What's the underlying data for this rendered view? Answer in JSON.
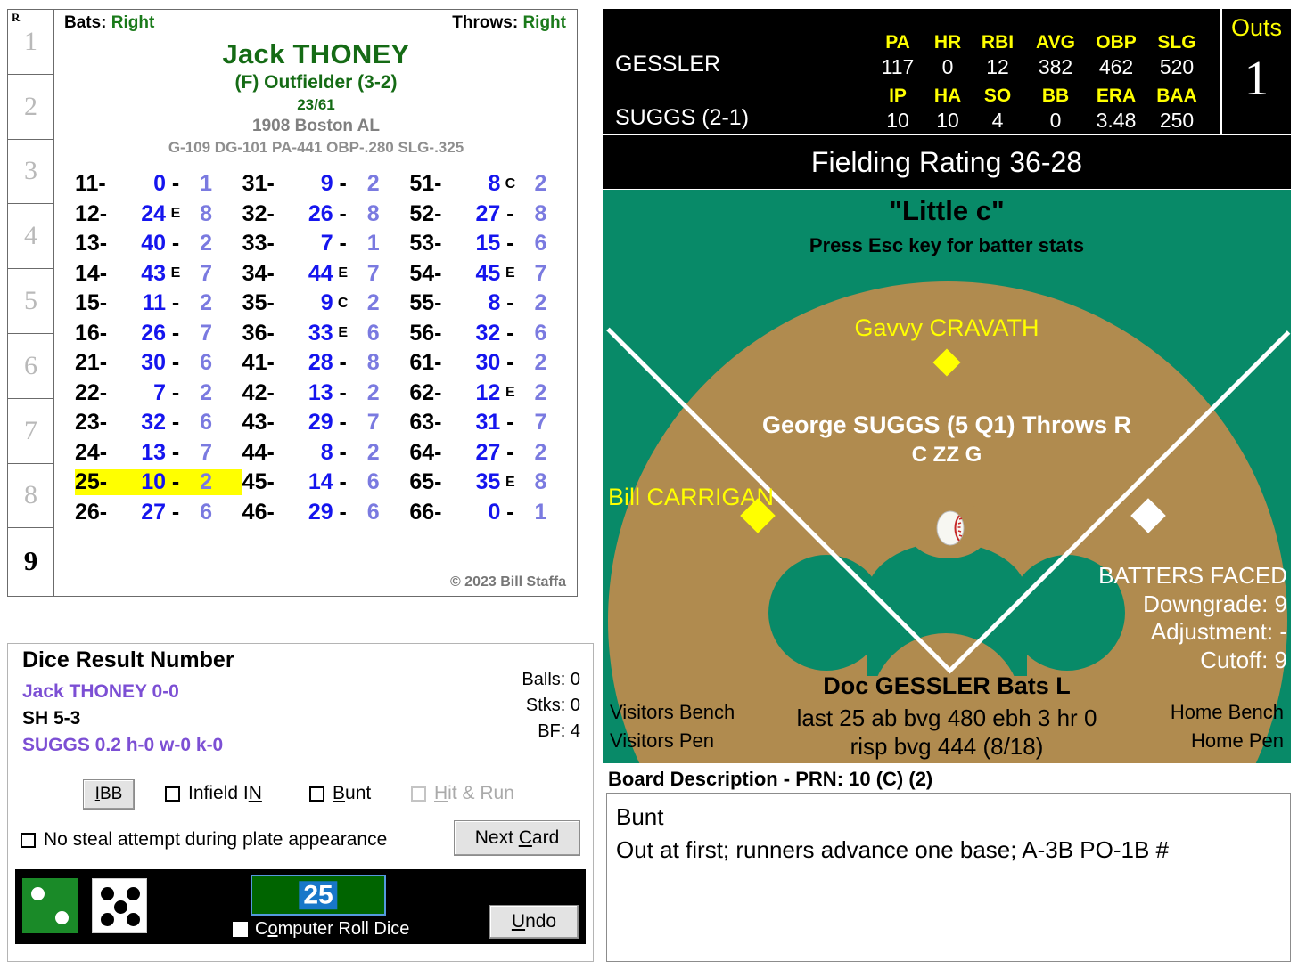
{
  "inning_column": {
    "header": "R",
    "innings": [
      "1",
      "2",
      "3",
      "4",
      "5",
      "6",
      "7",
      "8",
      "9"
    ],
    "current_index": 8
  },
  "batter_card": {
    "bats_label": "Bats:",
    "bats_value": "Right",
    "throws_label": "Throws:",
    "throws_value": "Right",
    "player_name": "Jack THONEY",
    "position": "(F) Outfielder (3-2)",
    "ratio": "23/61",
    "team_year": "1908 Boston AL",
    "stat_line": "G-109 DG-101 PA-441 OBP-.280 SLG-.325",
    "copyright": "© 2023 Bill Staffa",
    "rows": [
      [
        {
          "roll": "11-",
          "mid": "0",
          "sep": "-",
          "last": "1"
        },
        {
          "roll": "31-",
          "mid": "9",
          "sep": "-",
          "last": "2"
        },
        {
          "roll": "51-",
          "mid": "8",
          "sep": "C",
          "last": "2"
        }
      ],
      [
        {
          "roll": "12-",
          "mid": "24",
          "sep": "E",
          "last": "8"
        },
        {
          "roll": "32-",
          "mid": "26",
          "sep": "-",
          "last": "8"
        },
        {
          "roll": "52-",
          "mid": "27",
          "sep": "-",
          "last": "8"
        }
      ],
      [
        {
          "roll": "13-",
          "mid": "40",
          "sep": "-",
          "last": "2"
        },
        {
          "roll": "33-",
          "mid": "7",
          "sep": "-",
          "last": "1"
        },
        {
          "roll": "53-",
          "mid": "15",
          "sep": "-",
          "last": "6"
        }
      ],
      [
        {
          "roll": "14-",
          "mid": "43",
          "sep": "E",
          "last": "7"
        },
        {
          "roll": "34-",
          "mid": "44",
          "sep": "E",
          "last": "7"
        },
        {
          "roll": "54-",
          "mid": "45",
          "sep": "E",
          "last": "7"
        }
      ],
      [
        {
          "roll": "15-",
          "mid": "11",
          "sep": "-",
          "last": "2"
        },
        {
          "roll": "35-",
          "mid": "9",
          "sep": "C",
          "last": "2"
        },
        {
          "roll": "55-",
          "mid": "8",
          "sep": "-",
          "last": "2"
        }
      ],
      [
        {
          "roll": "16-",
          "mid": "26",
          "sep": "-",
          "last": "7"
        },
        {
          "roll": "36-",
          "mid": "33",
          "sep": "E",
          "last": "6"
        },
        {
          "roll": "56-",
          "mid": "32",
          "sep": "-",
          "last": "6"
        }
      ],
      [
        {
          "roll": "21-",
          "mid": "30",
          "sep": "-",
          "last": "6"
        },
        {
          "roll": "41-",
          "mid": "28",
          "sep": "-",
          "last": "8"
        },
        {
          "roll": "61-",
          "mid": "30",
          "sep": "-",
          "last": "2"
        }
      ],
      [
        {
          "roll": "22-",
          "mid": "7",
          "sep": "-",
          "last": "2"
        },
        {
          "roll": "42-",
          "mid": "13",
          "sep": "-",
          "last": "2"
        },
        {
          "roll": "62-",
          "mid": "12",
          "sep": "E",
          "last": "2"
        }
      ],
      [
        {
          "roll": "23-",
          "mid": "32",
          "sep": "-",
          "last": "6"
        },
        {
          "roll": "43-",
          "mid": "29",
          "sep": "-",
          "last": "7"
        },
        {
          "roll": "63-",
          "mid": "31",
          "sep": "-",
          "last": "7"
        }
      ],
      [
        {
          "roll": "24-",
          "mid": "13",
          "sep": "-",
          "last": "7"
        },
        {
          "roll": "44-",
          "mid": "8",
          "sep": "-",
          "last": "2"
        },
        {
          "roll": "64-",
          "mid": "27",
          "sep": "-",
          "last": "2"
        }
      ],
      [
        {
          "roll": "25-",
          "mid": "10",
          "sep": "-",
          "last": "2",
          "highlight": true
        },
        {
          "roll": "45-",
          "mid": "14",
          "sep": "-",
          "last": "6"
        },
        {
          "roll": "65-",
          "mid": "35",
          "sep": "E",
          "last": "8"
        }
      ],
      [
        {
          "roll": "26-",
          "mid": "27",
          "sep": "-",
          "last": "6"
        },
        {
          "roll": "46-",
          "mid": "29",
          "sep": "-",
          "last": "6"
        },
        {
          "roll": "66-",
          "mid": "0",
          "sep": "-",
          "last": "1"
        }
      ]
    ]
  },
  "dice_panel": {
    "title": "Dice Result Number",
    "batter_line": "Jack THONEY  0-0",
    "situation_line": "SH 5-3",
    "pitcher_line": "SUGGS  0.2  h-0  w-0  k-0",
    "balls": "Balls: 0",
    "strikes": "Stks: 0",
    "bf": "BF: 4",
    "ibb_label": "IBB",
    "infield_in_label": "Infield IN",
    "bunt_label": "Bunt",
    "hit_run_label": "Hit & Run",
    "no_steal_label": "No steal attempt during plate appearance",
    "next_card_label": "Next Card",
    "undo_label": "Undo",
    "computer_roll_label": "Computer Roll Dice",
    "dice_value": "25",
    "die_green_pips": 2,
    "die_white_pips": 5
  },
  "scoreboard": {
    "batter_name": "GESSLER",
    "batter_headers": [
      "PA",
      "HR",
      "RBI",
      "AVG",
      "OBP",
      "SLG"
    ],
    "batter_values": [
      "117",
      "0",
      "12",
      "382",
      "462",
      "520"
    ],
    "pitcher_name": "SUGGS (2-1)",
    "pitcher_headers": [
      "IP",
      "HA",
      "SO",
      "BB",
      "ERA",
      "BAA"
    ],
    "pitcher_values": [
      "10",
      "10",
      "4",
      "0",
      "3.48",
      "250"
    ],
    "outs_label": "Outs",
    "outs_value": "1",
    "fielding_rating": "Fielding Rating 36-28"
  },
  "field": {
    "little_c": "\"Little c\"",
    "esc_hint": "Press Esc key for batter stats",
    "outfielder": "Gavvy CRAVATH",
    "pitcher_line": "George SUGGS (5 Q1) Throws R",
    "pitcher_sub": "C ZZ G",
    "third_base_runner": "Bill CARRIGAN",
    "batters_faced_title": "BATTERS FACED",
    "downgrade": "Downgrade: 9",
    "adjustment": "Adjustment: -",
    "cutoff": "Cutoff: 9",
    "batter_name": "Doc GESSLER Bats L",
    "batter_line1": "last 25 ab bvg 480 ebh 3 hr 0",
    "batter_line2": "risp bvg 444 (8/18)",
    "visitors_bench": "Visitors Bench",
    "visitors_pen": "Visitors Pen",
    "home_bench": "Home Bench",
    "home_pen": "Home Pen"
  },
  "board_description": {
    "title": "Board Description - PRN: 10 (C) (2)",
    "line1": "Bunt",
    "line2": "Out at first; runners advance one base; A-3B PO-1B #"
  },
  "colors": {
    "field_green": "#088a68",
    "dirt": "#b08b4f",
    "highlight_yellow": "#ffff00",
    "accent_blue": "#1515ee",
    "purple": "#7c4fd4",
    "card_green": "#156b15"
  }
}
